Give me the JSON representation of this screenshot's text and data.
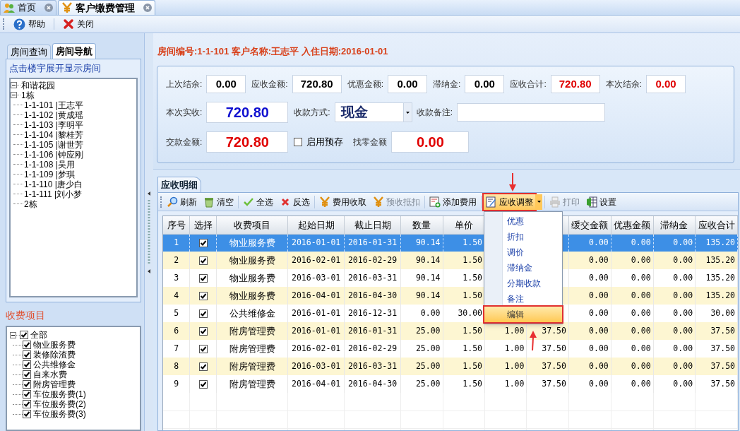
{
  "tabs": [
    {
      "label": "首页",
      "kind": "home",
      "selected": false
    },
    {
      "label": "客户缴费管理",
      "kind": "fee",
      "selected": true
    }
  ],
  "toolbar": [
    {
      "label": "帮助",
      "kind": "help"
    },
    {
      "label": "关闭",
      "kind": "close"
    }
  ],
  "left_panel": {
    "tabs": [
      {
        "label": "房间查询",
        "selected": false
      },
      {
        "label": "房间导航",
        "selected": true
      }
    ],
    "hint": "点击楼宇展开显示房间",
    "room_tree": [
      {
        "label": "和谐花园",
        "expanded": true,
        "children": [
          {
            "label": "1栋",
            "expanded": true,
            "children": [
              {
                "label": "1-1-101 |王志平"
              },
              {
                "label": "1-1-102 |黄成瑶"
              },
              {
                "label": "1-1-103 |李明平"
              },
              {
                "label": "1-1-104 |黎桂芳"
              },
              {
                "label": "1-1-105 |谢世芳"
              },
              {
                "label": "1-1-106 |钟应刚"
              },
              {
                "label": "1-1-108 |吴用"
              },
              {
                "label": "1-1-109 |梦琪"
              },
              {
                "label": "1-1-110 |唐少白"
              },
              {
                "label": "1-1-111 |刘小梦"
              }
            ]
          },
          {
            "label": "2栋"
          }
        ]
      }
    ],
    "fee_title": "收费项目",
    "fee_tree": [
      {
        "label": "全部",
        "checked": true,
        "expanded": true,
        "children": [
          {
            "label": "物业服务费",
            "checked": true
          },
          {
            "label": "装修除渣费",
            "checked": true
          },
          {
            "label": "公共维修金",
            "checked": true
          },
          {
            "label": "自来水费",
            "checked": true
          },
          {
            "label": "附房管理费",
            "checked": true
          },
          {
            "label": "车位服务费(1)",
            "checked": true
          },
          {
            "label": "车位服务费(2)",
            "checked": true
          },
          {
            "label": "车位服务费(3)",
            "checked": true
          }
        ]
      }
    ]
  },
  "info": "房间编号:1-1-101 客户名称:王志平 入住日期:2016-01-01",
  "form": {
    "rows": [
      [
        {
          "kind": "field",
          "label": "上次结余:",
          "value": "0.00",
          "color": "#000000",
          "large": false
        },
        {
          "kind": "field",
          "label": "应收金额:",
          "value": "720.80",
          "color": "#000000",
          "large": false
        },
        {
          "kind": "field",
          "label": "优惠金额:",
          "value": "0.00",
          "color": "#000000",
          "large": false
        },
        {
          "kind": "field",
          "label": "滞纳金:",
          "value": "0.00",
          "color": "#000000",
          "large": false
        },
        {
          "kind": "field",
          "label": "应收合计:",
          "value": "720.80",
          "color": "#e00000",
          "large": false
        },
        {
          "kind": "field",
          "label": "本次结余:",
          "value": "0.00",
          "color": "#e00000",
          "large": false
        }
      ],
      [
        {
          "kind": "field",
          "label": "本次实收:",
          "value": "720.80",
          "color": "#1010d0",
          "large": true
        },
        {
          "kind": "dropdown",
          "label": "收款方式:",
          "value": "现金"
        },
        {
          "kind": "field",
          "label": "收款备注:",
          "large": false
        }
      ],
      [
        {
          "kind": "field",
          "label": "交款金额:",
          "value": "720.80",
          "color": "#e00000",
          "large": true
        },
        {
          "kind": "checkbox",
          "label": "启用预存",
          "checked": false
        },
        {
          "kind": "field",
          "label": "找零金额",
          "value": "0.00",
          "color": "#e00000",
          "large": true
        }
      ]
    ]
  },
  "detail": {
    "tab": "应收明细",
    "toolbar": [
      {
        "label": "刷新",
        "kind": "refresh",
        "disabled": false,
        "active": false
      },
      {
        "label": "清空",
        "kind": "clear",
        "disabled": false,
        "active": false
      },
      {
        "label": "全选",
        "kind": "select_all",
        "disabled": false,
        "active": false
      },
      {
        "label": "反选",
        "kind": "invert",
        "disabled": false,
        "active": false
      },
      {
        "label": "费用收取",
        "kind": "collect",
        "disabled": false,
        "active": false
      },
      {
        "label": "预收抵扣",
        "kind": "collect",
        "disabled": true,
        "active": false
      },
      {
        "label": "添加费用",
        "kind": "add",
        "disabled": false,
        "active": false
      },
      {
        "label": "应收调整",
        "kind": "adjust",
        "disabled": false,
        "active": true,
        "menu": [
          {
            "label": "优惠",
            "selected": false
          },
          {
            "label": "折扣",
            "selected": false
          },
          {
            "label": "调价",
            "selected": false
          },
          {
            "label": "滞纳金",
            "selected": false
          },
          {
            "label": "分期收款",
            "selected": false
          },
          {
            "label": "备注",
            "selected": false
          },
          {
            "label": "编辑",
            "selected": true
          }
        ]
      },
      {
        "label": "打印",
        "kind": "print",
        "disabled": true,
        "active": false
      },
      {
        "label": "设置",
        "kind": "settings",
        "disabled": false,
        "active": false
      }
    ],
    "table": {
      "columns": [
        "序号",
        "选择",
        "收费项目",
        "起始日期",
        "截止日期",
        "数量",
        "单价",
        null,
        null,
        "缓交金额",
        "优惠金额",
        "滞纳金",
        "应收合计"
      ],
      "rows": [
        {
          "selected": true,
          "checked": true,
          "cells": [
            "1",
            "",
            "物业服务费",
            "2016-01-01",
            "2016-01-31",
            "90.14",
            "1.50",
            null,
            null,
            "0.00",
            "0.00",
            "0.00",
            "135.20"
          ]
        },
        {
          "selected": false,
          "checked": true,
          "cells": [
            "2",
            "",
            "物业服务费",
            "2016-02-01",
            "2016-02-29",
            "90.14",
            "1.50",
            null,
            null,
            "0.00",
            "0.00",
            "0.00",
            "135.20"
          ]
        },
        {
          "selected": false,
          "checked": true,
          "cells": [
            "3",
            "",
            "物业服务费",
            "2016-03-01",
            "2016-03-31",
            "90.14",
            "1.50",
            null,
            null,
            "0.00",
            "0.00",
            "0.00",
            "135.20"
          ]
        },
        {
          "selected": false,
          "checked": true,
          "cells": [
            "4",
            "",
            "物业服务费",
            "2016-04-01",
            "2016-04-30",
            "90.14",
            "1.50",
            null,
            null,
            "0.00",
            "0.00",
            "0.00",
            "135.20"
          ]
        },
        {
          "selected": false,
          "checked": true,
          "cells": [
            "5",
            "",
            "公共维修金",
            "2016-01-01",
            "2016-12-31",
            "0.00",
            "30.00",
            null,
            null,
            "0.00",
            "0.00",
            "0.00",
            "30.00"
          ]
        },
        {
          "selected": false,
          "checked": true,
          "cells": [
            "6",
            "",
            "附房管理费",
            "2016-01-01",
            "2016-01-31",
            "25.00",
            "1.50",
            "1.00",
            "37.50",
            "0.00",
            "0.00",
            "0.00",
            "37.50"
          ]
        },
        {
          "selected": false,
          "checked": true,
          "cells": [
            "7",
            "",
            "附房管理费",
            "2016-02-01",
            "2016-02-29",
            "25.00",
            "1.50",
            "1.00",
            "37.50",
            "0.00",
            "0.00",
            "0.00",
            "37.50"
          ]
        },
        {
          "selected": false,
          "checked": true,
          "cells": [
            "8",
            "",
            "附房管理费",
            "2016-03-01",
            "2016-03-31",
            "25.00",
            "1.50",
            "1.00",
            "37.50",
            "0.00",
            "0.00",
            "0.00",
            "37.50"
          ]
        },
        {
          "selected": false,
          "checked": true,
          "cells": [
            "9",
            "",
            "附房管理费",
            "2016-04-01",
            "2016-04-30",
            "25.00",
            "1.50",
            "1.00",
            "37.50",
            "0.00",
            "0.00",
            "0.00",
            "37.50"
          ]
        }
      ]
    }
  }
}
